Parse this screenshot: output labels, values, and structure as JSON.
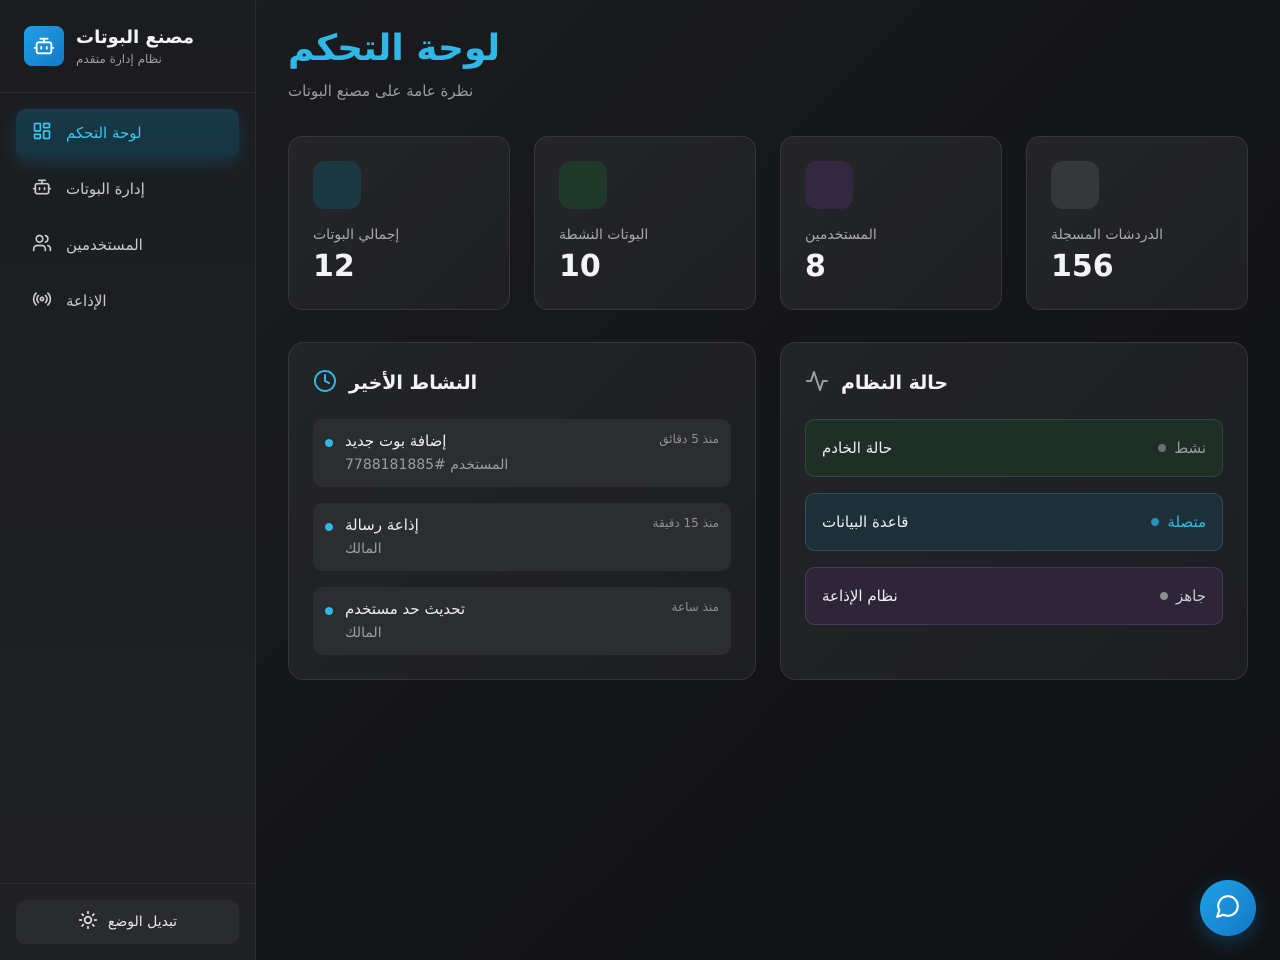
{
  "brand": {
    "title": "مصنع البوتات",
    "subtitle": "نظام إدارة متقدم",
    "icon": "robot-icon"
  },
  "sidebar": {
    "items": [
      {
        "label": "لوحة التحكم",
        "icon": "dashboard-icon",
        "active": true
      },
      {
        "label": "إدارة البوتات",
        "icon": "robot-icon",
        "active": false
      },
      {
        "label": "المستخدمين",
        "icon": "users-icon",
        "active": false
      },
      {
        "label": "الإذاعة",
        "icon": "broadcast-icon",
        "active": false
      }
    ],
    "mode_button": "تبديل الوضع",
    "mode_icon": "sun-icon"
  },
  "header": {
    "title": "لوحة التحكم",
    "subtitle": "نظرة عامة على مصنع البوتات"
  },
  "stats": [
    {
      "label": "إجمالي البوتات",
      "value": "12",
      "color": "#1d3a44"
    },
    {
      "label": "البوتات النشطة",
      "value": "10",
      "color": "#1f3a2a"
    },
    {
      "label": "المستخدمين",
      "value": "8",
      "color": "#33283f"
    },
    {
      "label": "الدردشات المسجلة",
      "value": "156",
      "color": "#36373b"
    }
  ],
  "activity": {
    "title": "النشاط الأخير",
    "icon": "clock-icon",
    "items": [
      {
        "title": "إضافة بوت جديد",
        "sub": "المستخدم #7788181885",
        "time": "منذ 5 دقائق"
      },
      {
        "title": "إذاعة رسالة",
        "sub": "المالك",
        "time": "منذ 15 دقيقة"
      },
      {
        "title": "تحديث حد مستخدم",
        "sub": "المالك",
        "time": "منذ ساعة"
      }
    ]
  },
  "system": {
    "title": "حالة النظام",
    "icon": "pulse-icon",
    "items": [
      {
        "name": "حالة الخادم",
        "state": "نشط",
        "bg": "#1f2e26",
        "border": "#2b4a38",
        "state_color": "#9a9ca3",
        "dot": "#6b6d73"
      },
      {
        "name": "قاعدة البيانات",
        "state": "متصلة",
        "bg": "#1d2f37",
        "border": "#27505e",
        "state_color": "#2fb8e6",
        "dot": "#2a8fbf"
      },
      {
        "name": "نظام الإذاعة",
        "state": "جاهز",
        "bg": "#2e2538",
        "border": "#4a3a5a",
        "state_color": "#c9cbd0",
        "dot": "#8e9096"
      }
    ]
  },
  "chat_button": {
    "icon": "chat-bubble-icon"
  },
  "colors": {
    "accent": "#2fb8e6",
    "brand": "#1ea1e6"
  }
}
